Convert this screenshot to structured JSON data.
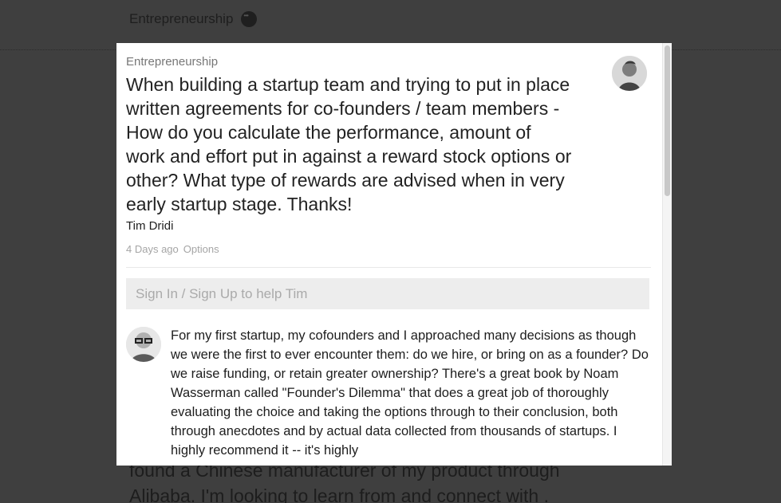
{
  "background": {
    "topic_title": "Entrepreneurship",
    "post_text": "found a Chinese manufacturer of my product through Alibaba. I'm looking to learn from and connect with ."
  },
  "modal": {
    "topic": "Entrepreneurship",
    "question": "When building a startup team and trying to put in place written agreements for co-founders / team members - How do you calculate the performance, amount of work and effort put in against a reward stock options or other? What type of rewards are advised when in very early startup stage. Thanks!",
    "author": "Tim Dridi",
    "timestamp": "4 Days ago",
    "options_label": "Options",
    "signin_prompt": "Sign In / Sign Up to help Tim",
    "answer_text": "For my first startup, my cofounders and I approached many decisions as though we were the first to ever encounter them: do we hire, or bring on as a founder? Do we raise funding, or retain greater ownership? There's a great book by Noam Wasserman called \"Founder's Dilemma\" that does a great job of thoroughly evaluating the choice and taking the options through to their conclusion, both through anecdotes and by actual data collected from thousands of startups. I highly recommend it -- it's highly"
  },
  "icons": {
    "more": "more-icon",
    "asker_avatar": "asker-avatar",
    "answerer_avatar": "answerer-avatar"
  },
  "colors": {
    "overlay": "#3f3f3f",
    "modal_bg": "#ffffff",
    "muted_text": "#a5a5a5",
    "signin_bg": "#ededed"
  }
}
